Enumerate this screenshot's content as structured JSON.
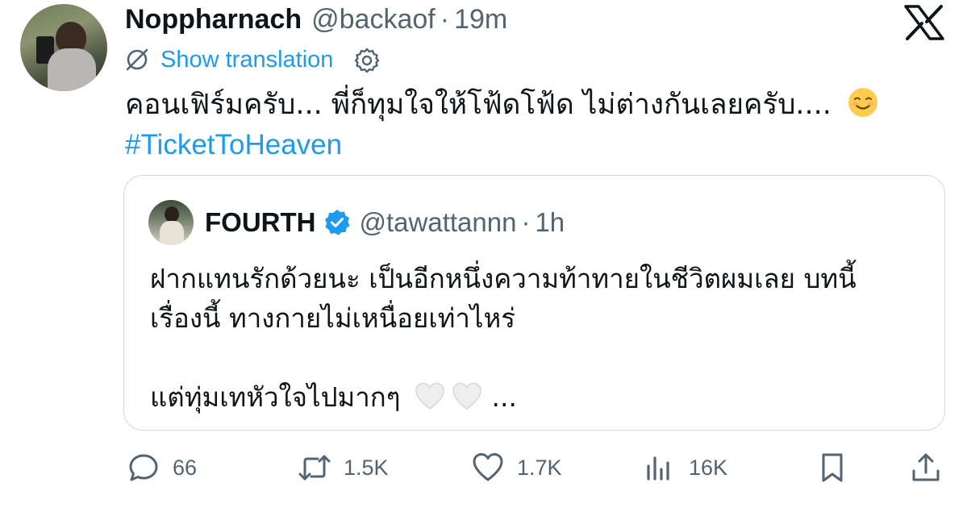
{
  "author": {
    "name": "Noppharnach",
    "handle": "@backaof",
    "separator": "·",
    "time": "19m"
  },
  "translation": {
    "label": "Show translation"
  },
  "tweet": {
    "text": "คอนเฟิร์มครับ... พี่ก็ทุมใจให้โฟ้ดโฟ้ด ไม่ต่างกันเลยครับ....",
    "emoji": "smiling-face-icon",
    "hashtag": "#TicketToHeaven"
  },
  "quoted": {
    "name": "FOURTH",
    "handle": "@tawattannn",
    "separator": "·",
    "time": "1h",
    "verified": true,
    "line1": "ฝากแทนรักด้วยนะ เป็นอีกหนึ่งความท้าทายในชีวิตผมเลย บทนี้",
    "line2": "เรื่องนี้ ทางกายไม่เหนื่อยเท่าไหร่",
    "line3": "แต่ทุ่มเทหัวใจไปมากๆ",
    "line3_suffix": "..."
  },
  "actions": {
    "replies": "66",
    "reposts": "1.5K",
    "likes": "1.7K",
    "views": "16K"
  },
  "colors": {
    "accent": "#1d9bf0",
    "secondary_text": "#536471",
    "border": "#cfd9de"
  }
}
